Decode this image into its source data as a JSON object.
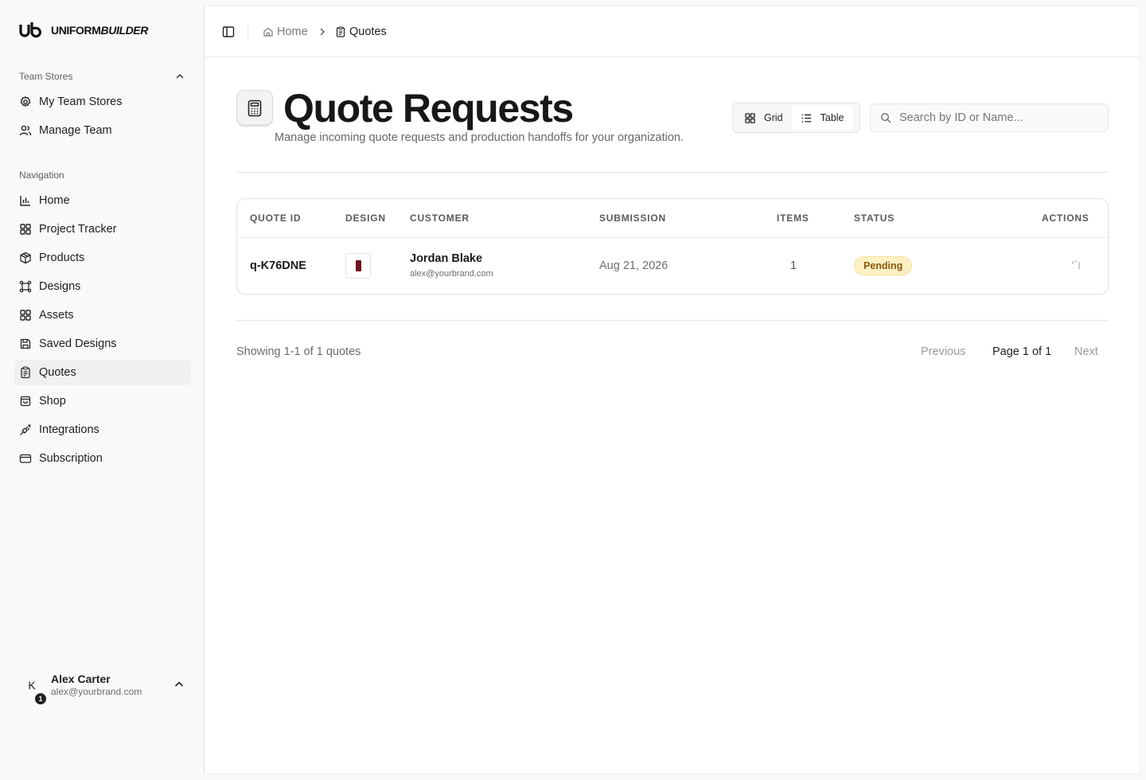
{
  "brand": {
    "name_regular": "UNIFORM",
    "name_italic": "BUILDER"
  },
  "sidebar": {
    "team_group": {
      "title": "Team Stores",
      "items": [
        {
          "label": "My Team Stores",
          "icon": "gear-icon"
        },
        {
          "label": "Manage Team",
          "icon": "users-icon"
        }
      ]
    },
    "nav_group": {
      "title": "Navigation",
      "items": [
        {
          "label": "Home",
          "icon": "bar-chart-icon"
        },
        {
          "label": "Project Tracker",
          "icon": "layout-grid-icon"
        },
        {
          "label": "Products",
          "icon": "package-icon"
        },
        {
          "label": "Designs",
          "icon": "frame-icon"
        },
        {
          "label": "Assets",
          "icon": "layout-grid-icon"
        },
        {
          "label": "Saved Designs",
          "icon": "save-icon"
        },
        {
          "label": "Quotes",
          "icon": "clipboard-icon",
          "active": true
        },
        {
          "label": "Shop",
          "icon": "shopping-bag-icon"
        },
        {
          "label": "Integrations",
          "icon": "plug-icon"
        },
        {
          "label": "Subscription",
          "icon": "credit-card-icon"
        }
      ]
    },
    "user": {
      "initial": "K",
      "badge": "1",
      "name": "Alex Carter",
      "email": "alex@yourbrand.com"
    }
  },
  "breadcrumb": {
    "home": "Home",
    "current": "Quotes"
  },
  "page": {
    "title": "Quote Requests",
    "subtitle": "Manage incoming quote requests and production handoffs for your organization."
  },
  "view_toggle": {
    "grid_label": "Grid",
    "table_label": "Table",
    "selected": "Table"
  },
  "search": {
    "placeholder": "Search by ID or Name...",
    "value": ""
  },
  "table": {
    "columns": [
      "QUOTE ID",
      "DESIGN",
      "CUSTOMER",
      "SUBMISSION",
      "ITEMS",
      "STATUS",
      "ACTIONS"
    ],
    "rows": [
      {
        "quote_id": "q-K76DNE",
        "customer_name": "Jordan Blake",
        "customer_email": "alex@yourbrand.com",
        "submission": "Aug 21, 2026",
        "items": "1",
        "status": "Pending"
      }
    ]
  },
  "pagination": {
    "summary": "Showing 1-1 of 1 quotes",
    "previous": "Previous",
    "page": "Page 1 of 1",
    "next": "Next"
  },
  "colors": {
    "jersey": "#6e1420",
    "pending_bg": "#fdf1c4",
    "pending_text": "#8a5a08"
  }
}
